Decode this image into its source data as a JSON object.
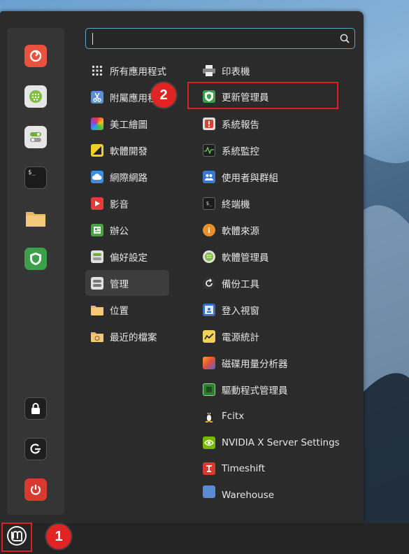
{
  "search": {
    "value": "",
    "placeholder": ""
  },
  "sidebar": {
    "favorites": [
      {
        "name": "firefox-icon"
      },
      {
        "name": "software-manager-icon"
      },
      {
        "name": "settings-icon"
      },
      {
        "name": "terminal-icon"
      },
      {
        "name": "files-icon"
      },
      {
        "name": "update-manager-icon"
      }
    ],
    "session": [
      {
        "name": "lock-icon"
      },
      {
        "name": "logout-icon"
      },
      {
        "name": "power-icon"
      }
    ]
  },
  "categories": [
    {
      "label": "所有應用程式"
    },
    {
      "label": "附屬應用程式"
    },
    {
      "label": "美工繪圖"
    },
    {
      "label": "軟體開發"
    },
    {
      "label": "網際網路"
    },
    {
      "label": "影音"
    },
    {
      "label": "辦公"
    },
    {
      "label": "偏好設定"
    },
    {
      "label": "管理"
    },
    {
      "label": "位置"
    },
    {
      "label": "最近的檔案"
    }
  ],
  "apps": [
    {
      "label": "印表機"
    },
    {
      "label": "更新管理員"
    },
    {
      "label": "系統報告"
    },
    {
      "label": "系統監控"
    },
    {
      "label": "使用者與群組"
    },
    {
      "label": "終端機"
    },
    {
      "label": "軟體來源"
    },
    {
      "label": "軟體管理員"
    },
    {
      "label": "備份工具"
    },
    {
      "label": "登入視窗"
    },
    {
      "label": "電源統計"
    },
    {
      "label": "磁碟用量分析器"
    },
    {
      "label": "驅動程式管理員"
    },
    {
      "label": "Fcitx"
    },
    {
      "label": "NVIDIA X Server Settings"
    },
    {
      "label": "Timeshift"
    },
    {
      "label": "Warehouse"
    }
  ],
  "annotations": {
    "step1": "1",
    "step2": "2"
  },
  "colors": {
    "accent_red": "#e02020",
    "search_border": "#5aa7c7"
  }
}
